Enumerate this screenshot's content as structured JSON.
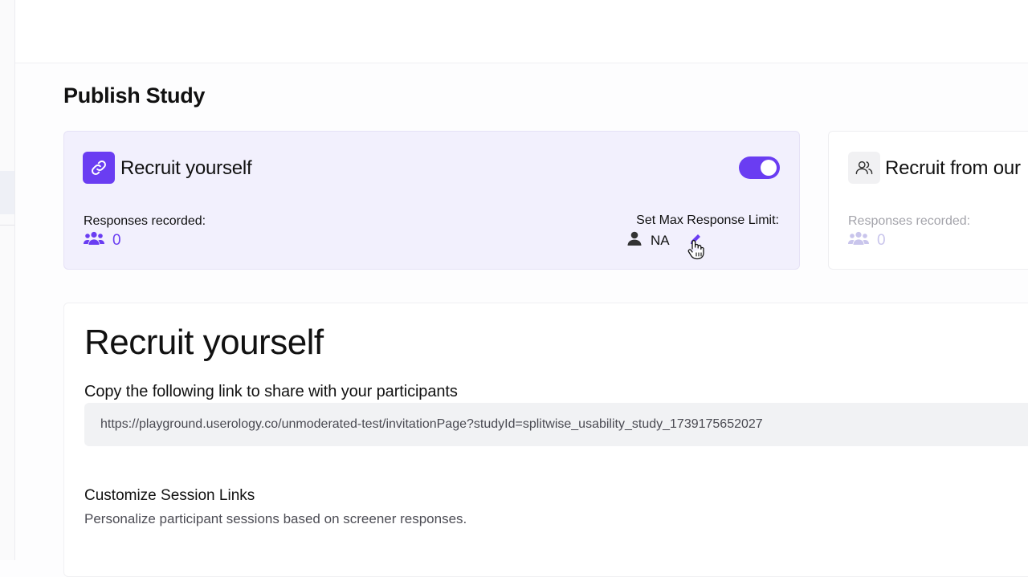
{
  "page": {
    "title": "Publish Study"
  },
  "colors": {
    "accent": "#6a3df2",
    "card_bg": "#f2f0fd"
  },
  "recruit_self": {
    "title": "Recruit yourself",
    "icon": "link-icon",
    "enabled": true,
    "responses_label": "Responses recorded:",
    "responses_count": "0",
    "max_limit_label": "Set Max Response Limit:",
    "max_limit_value": "NA"
  },
  "recruit_panel": {
    "title": "Recruit from our",
    "icon": "users-icon",
    "responses_label": "Responses recorded:",
    "responses_count": "0"
  },
  "section": {
    "title": "Recruit yourself",
    "copy_label": "Copy the following link to share with your participants",
    "link": "https://playground.userology.co/unmoderated-test/invitationPage?studyId=splitwise_usability_study_1739175652027",
    "customize_title": "Customize Session Links",
    "customize_desc": "Personalize participant sessions based on screener responses."
  }
}
